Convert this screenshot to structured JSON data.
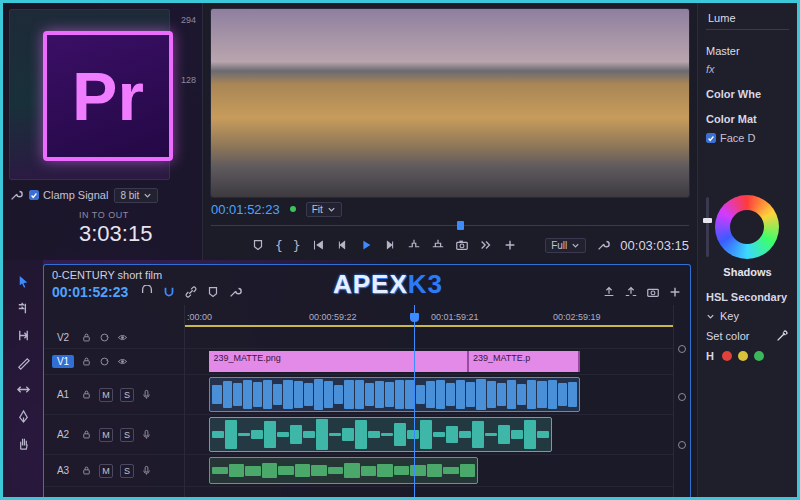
{
  "logo": {
    "text": "Pr"
  },
  "watermark": {
    "prefix": "APEX",
    "suffix": "K3"
  },
  "source": {
    "scale": [
      "294",
      "128"
    ],
    "clamp_signal": {
      "label": "Clamp Signal",
      "checked": true
    },
    "bit_depth": "8 bit",
    "range_label": "IN TO OUT",
    "range_value": "3:03:15"
  },
  "program": {
    "timecode": "00:01:52:23",
    "zoom": "Fit",
    "quality": "Full",
    "duration": "00:03:03:15",
    "mark_in": "{",
    "mark_out": "}",
    "playhead": {
      "level": 0.52
    }
  },
  "timeline": {
    "title": "0-CENTURY short film",
    "timecode": "00:01:52:23",
    "ruler": [
      ":00:00",
      "00:00:59:22",
      "00:01:59:21",
      "00:02:59:19"
    ],
    "playhead": {
      "level": 0.47
    },
    "audio_buttons": {
      "mute": "M",
      "solo": "S"
    },
    "tracks": [
      {
        "label": "V2",
        "kind": "video",
        "selected": false
      },
      {
        "label": "V1",
        "kind": "video",
        "selected": true
      },
      {
        "label": "A1",
        "kind": "audio",
        "selected": false
      },
      {
        "label": "A2",
        "kind": "audio",
        "selected": false
      },
      {
        "label": "A3",
        "kind": "audio",
        "selected": false
      }
    ],
    "video_clips": [
      {
        "name": "239_MATTE.png",
        "track": "V1"
      },
      {
        "name": "239_MATTE.p",
        "track": "V1"
      }
    ],
    "audio_clips": [
      {
        "track": "A1",
        "color": "#4a90d9",
        "levels": [
          0.6,
          0.8,
          0.7,
          0.9,
          0.75,
          0.85,
          0.65,
          0.9,
          0.8,
          0.7,
          0.95,
          0.8,
          0.6,
          0.85,
          0.9,
          0.7,
          0.8,
          0.75,
          0.9,
          0.85,
          0.6,
          0.8,
          0.9,
          0.7,
          0.85,
          0.75,
          0.95,
          0.8,
          0.7,
          0.9,
          0.65,
          0.85,
          0.8,
          0.9,
          0.7,
          0.75
        ]
      },
      {
        "track": "A2",
        "color": "#3fb7a8",
        "levels": [
          0.2,
          0.9,
          0.1,
          0.3,
          0.8,
          0.15,
          0.6,
          0.2,
          0.95,
          0.1,
          0.4,
          0.85,
          0.2,
          0.1,
          0.7,
          0.3,
          0.9,
          0.15,
          0.5,
          0.2,
          0.8,
          0.1,
          0.6,
          0.3,
          0.9,
          0.2
        ]
      },
      {
        "track": "A3",
        "color": "#49a86a",
        "levels": [
          0.3,
          0.5,
          0.4,
          0.6,
          0.35,
          0.55,
          0.45,
          0.3,
          0.6,
          0.4,
          0.5,
          0.35,
          0.45,
          0.55,
          0.3,
          0.5
        ]
      }
    ]
  },
  "lumetri": {
    "tab": "Lume",
    "section": "Master",
    "fx": "fx",
    "rows": [
      "Color Whe",
      "Color Mat"
    ],
    "face_detection": {
      "label": "Face D",
      "checked": true
    },
    "wheel_slider": {
      "level": 0.6
    },
    "wheel_label": "Shadows",
    "hsl": "HSL Secondary",
    "key": {
      "label": "Key",
      "expanded": true
    },
    "set_color": "Set color",
    "channel": "H",
    "swatches": [
      {
        "color": "#e0413a"
      },
      {
        "color": "#d9c23a"
      },
      {
        "color": "#3cb85a"
      }
    ]
  }
}
